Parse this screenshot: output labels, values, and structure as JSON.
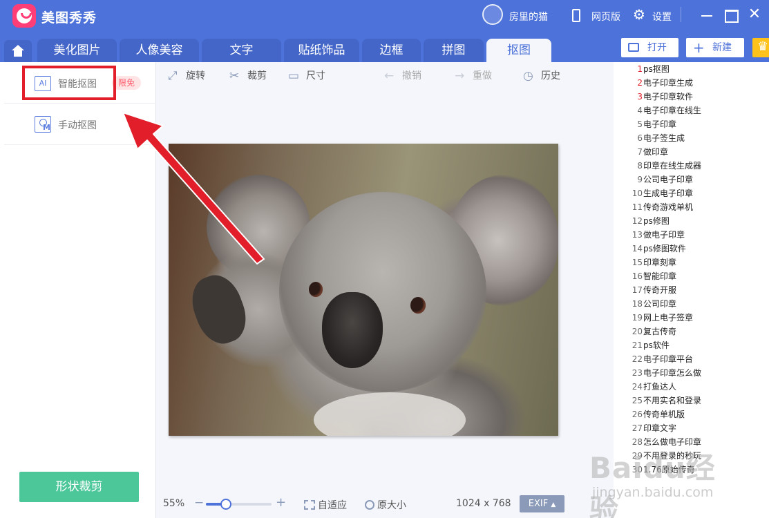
{
  "titlebar": {
    "app_title": "美图秀秀",
    "user_name": "房里的猫",
    "web_version_label": "网页版",
    "settings_label": "设置"
  },
  "tabs": {
    "items": [
      "美化图片",
      "人像美容",
      "文字",
      "贴纸饰品",
      "边框",
      "拼图",
      "抠图"
    ],
    "active": "抠图"
  },
  "top_buttons": {
    "open_label": "打开",
    "new_label": "新建"
  },
  "left_panel": {
    "ai_cutout_icon": "AI",
    "ai_cutout_label": "智能抠图",
    "free_badge": "限免",
    "manual_cutout_label": "手动抠图",
    "shape_crop_label": "形状裁剪"
  },
  "toolbar": {
    "rotate_label": "旋转",
    "crop_label": "裁剪",
    "size_label": "尺寸",
    "undo_label": "撤销",
    "redo_label": "重做",
    "history_label": "历史"
  },
  "bottom_bar": {
    "zoom_percent": "55%",
    "zoom_level": 0.3,
    "fit_label": "自适应",
    "original_size_label": "原大小",
    "image_dimensions": "1024 x 768",
    "exif_label": "EXIF"
  },
  "right_list": [
    {
      "num": "1",
      "text": "ps抠图"
    },
    {
      "num": "2",
      "text": "电子印章生成"
    },
    {
      "num": "3",
      "text": "电子印章软件"
    },
    {
      "num": "4",
      "text": "电子印章在线生"
    },
    {
      "num": "5",
      "text": "电子印章"
    },
    {
      "num": "6",
      "text": "电子签生成"
    },
    {
      "num": "7",
      "text": "做印章"
    },
    {
      "num": "8",
      "text": "印章在线生成器"
    },
    {
      "num": "9",
      "text": "公司电子印章"
    },
    {
      "num": "10",
      "text": "生成电子印章"
    },
    {
      "num": "11",
      "text": "传奇游戏单机"
    },
    {
      "num": "12",
      "text": "ps修图"
    },
    {
      "num": "13",
      "text": "做电子印章"
    },
    {
      "num": "14",
      "text": "ps修图软件"
    },
    {
      "num": "15",
      "text": "印章刻章"
    },
    {
      "num": "16",
      "text": "智能印章"
    },
    {
      "num": "17",
      "text": "传奇开服"
    },
    {
      "num": "18",
      "text": "公司印章"
    },
    {
      "num": "19",
      "text": "网上电子签章"
    },
    {
      "num": "20",
      "text": "复古传奇"
    },
    {
      "num": "21",
      "text": "ps软件"
    },
    {
      "num": "22",
      "text": "电子印章平台"
    },
    {
      "num": "23",
      "text": "电子印章怎么做"
    },
    {
      "num": "24",
      "text": "打鱼达人"
    },
    {
      "num": "25",
      "text": "不用实名和登录"
    },
    {
      "num": "26",
      "text": "传奇单机版"
    },
    {
      "num": "27",
      "text": "印章文字"
    },
    {
      "num": "28",
      "text": "怎么做电子印章"
    },
    {
      "num": "29",
      "text": "不用登录的秒玩"
    },
    {
      "num": "30",
      "text": "1.76原始传奇"
    }
  ],
  "watermark": {
    "logo": "Baidu经验",
    "url": "jingyan.baidu.com"
  },
  "colors": {
    "brand_blue": "#4d72d9",
    "highlight_red": "#e21e2a",
    "shape_crop_green": "#4cc79a"
  }
}
